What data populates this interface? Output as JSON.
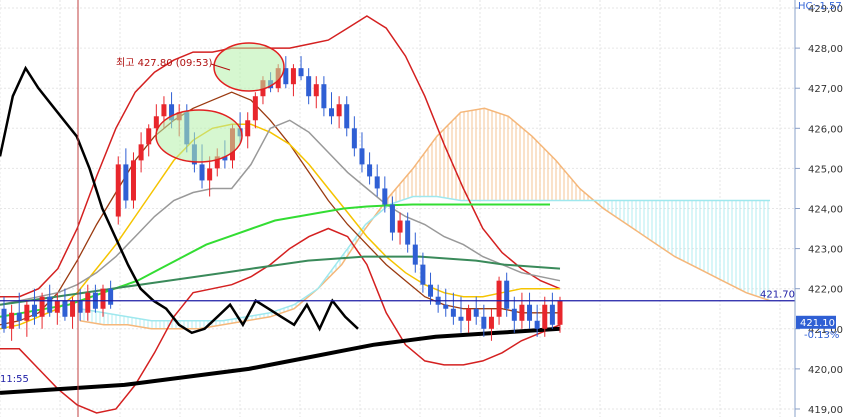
{
  "header": {
    "indicator_text": "HC:-1.57"
  },
  "chart_data": {
    "type": "candlestick",
    "ylim": [
      418.8,
      429.2
    ],
    "y_ticks": [
      "419,00",
      "420,00",
      "421,00",
      "422,00",
      "423,00",
      "424,00",
      "425,00",
      "426,00",
      "427,00",
      "428,00",
      "429,00"
    ],
    "y_tick_values": [
      419,
      420,
      421,
      422,
      423,
      424,
      425,
      426,
      427,
      428,
      429
    ],
    "annotations": {
      "high_label": "최고 427.80 (09:53)",
      "time_label": "11:55",
      "ref_line_label": "421.70",
      "ref_line_value": 421.7,
      "last_price_label": "421.10",
      "last_price_value": 421.1,
      "change_label": "-0.13%"
    },
    "candles": [
      [
        421.5,
        421.8,
        420.9,
        421.0
      ],
      [
        421.0,
        421.6,
        420.7,
        421.4
      ],
      [
        421.4,
        421.9,
        421.0,
        421.2
      ],
      [
        421.2,
        421.7,
        420.8,
        421.6
      ],
      [
        421.6,
        422.0,
        421.1,
        421.3
      ],
      [
        421.3,
        421.9,
        421.0,
        421.8
      ],
      [
        421.8,
        422.1,
        421.3,
        421.4
      ],
      [
        421.4,
        421.9,
        421.1,
        421.7
      ],
      [
        421.7,
        422.0,
        421.2,
        421.3
      ],
      [
        421.3,
        421.8,
        421.0,
        421.7
      ],
      [
        421.7,
        422.0,
        421.2,
        421.4
      ],
      [
        421.4,
        422.1,
        421.2,
        421.9
      ],
      [
        421.9,
        422.1,
        421.4,
        421.5
      ],
      [
        421.5,
        422.1,
        421.3,
        422.0
      ],
      [
        422.0,
        422.2,
        421.5,
        421.6
      ],
      [
        423.8,
        425.3,
        423.6,
        425.1
      ],
      [
        425.1,
        425.5,
        424.0,
        424.2
      ],
      [
        424.2,
        425.4,
        424.0,
        425.2
      ],
      [
        425.2,
        425.9,
        424.9,
        425.6
      ],
      [
        425.6,
        426.1,
        425.3,
        426.0
      ],
      [
        426.0,
        426.6,
        425.7,
        426.3
      ],
      [
        426.3,
        426.8,
        426.0,
        426.6
      ],
      [
        426.6,
        426.9,
        426.0,
        426.2
      ],
      [
        426.2,
        426.6,
        425.8,
        426.4
      ],
      [
        426.4,
        426.6,
        425.4,
        425.6
      ],
      [
        425.6,
        425.9,
        424.9,
        425.1
      ],
      [
        425.1,
        425.6,
        424.5,
        424.7
      ],
      [
        424.7,
        425.3,
        424.3,
        425.0
      ],
      [
        425.0,
        425.5,
        424.8,
        425.3
      ],
      [
        425.3,
        425.7,
        425.0,
        425.2
      ],
      [
        425.2,
        426.1,
        425.0,
        426.0
      ],
      [
        426.0,
        426.4,
        425.6,
        425.8
      ],
      [
        425.8,
        426.4,
        425.5,
        426.2
      ],
      [
        426.2,
        426.9,
        426.0,
        426.8
      ],
      [
        426.8,
        427.3,
        426.6,
        427.2
      ],
      [
        427.2,
        427.4,
        426.9,
        427.0
      ],
      [
        427.0,
        427.6,
        426.9,
        427.5
      ],
      [
        427.5,
        427.8,
        427.0,
        427.1
      ],
      [
        427.1,
        427.6,
        426.8,
        427.5
      ],
      [
        427.5,
        427.8,
        427.2,
        427.3
      ],
      [
        427.3,
        427.5,
        426.6,
        426.8
      ],
      [
        426.8,
        427.3,
        426.5,
        427.1
      ],
      [
        427.1,
        427.3,
        426.3,
        426.5
      ],
      [
        426.5,
        426.9,
        426.1,
        426.3
      ],
      [
        426.3,
        426.8,
        426.0,
        426.6
      ],
      [
        426.6,
        426.8,
        425.8,
        426.0
      ],
      [
        426.0,
        426.3,
        425.3,
        425.5
      ],
      [
        425.5,
        425.9,
        424.9,
        425.1
      ],
      [
        425.1,
        425.4,
        424.6,
        424.8
      ],
      [
        424.8,
        425.1,
        424.3,
        424.5
      ],
      [
        424.5,
        424.8,
        423.9,
        424.1
      ],
      [
        424.1,
        424.3,
        423.2,
        423.4
      ],
      [
        423.4,
        423.9,
        423.1,
        423.7
      ],
      [
        423.7,
        423.9,
        422.9,
        423.1
      ],
      [
        423.1,
        423.4,
        422.4,
        422.6
      ],
      [
        422.6,
        422.9,
        421.9,
        422.1
      ],
      [
        422.1,
        422.4,
        421.6,
        421.8
      ],
      [
        421.8,
        422.1,
        421.4,
        421.6
      ],
      [
        421.6,
        422.0,
        421.3,
        421.5
      ],
      [
        421.5,
        421.9,
        421.1,
        421.3
      ],
      [
        421.3,
        421.8,
        420.9,
        421.2
      ],
      [
        421.2,
        421.6,
        420.9,
        421.5
      ],
      [
        421.5,
        421.8,
        421.1,
        421.3
      ],
      [
        421.3,
        421.6,
        420.8,
        421.0
      ],
      [
        421.0,
        421.5,
        420.7,
        421.3
      ],
      [
        421.3,
        422.3,
        421.1,
        422.2
      ],
      [
        422.2,
        422.4,
        421.3,
        421.5
      ],
      [
        421.5,
        421.8,
        420.9,
        421.2
      ],
      [
        421.2,
        421.9,
        421.0,
        421.6
      ],
      [
        421.6,
        421.9,
        421.0,
        421.2
      ],
      [
        421.2,
        421.6,
        420.8,
        421.0
      ],
      [
        421.0,
        421.8,
        420.8,
        421.6
      ],
      [
        421.6,
        421.9,
        421.0,
        421.1
      ],
      [
        421.1,
        421.8,
        420.9,
        421.7
      ]
    ],
    "lines": {
      "upper_band": [
        421.8,
        421.8,
        422.0,
        422.5,
        423.5,
        424.8,
        426.0,
        426.9,
        427.4,
        427.7,
        427.9,
        427.9,
        428.0,
        428.0,
        428.0,
        428.0,
        428.1,
        428.2,
        428.5,
        428.8,
        428.5,
        427.8,
        426.8,
        425.6,
        424.5,
        423.5,
        422.9,
        422.5,
        422.2,
        422.0
      ],
      "lower_band": [
        420.5,
        420.5,
        420.0,
        419.5,
        419.1,
        418.9,
        419.0,
        419.6,
        420.4,
        421.3,
        421.9,
        422.0,
        422.1,
        422.3,
        422.6,
        423.0,
        423.3,
        423.5,
        423.3,
        422.6,
        421.4,
        420.6,
        420.2,
        420.1,
        420.1,
        420.2,
        420.4,
        420.7,
        420.9,
        421.1
      ],
      "middle_band": [
        421.1,
        421.2,
        421.4,
        421.9,
        422.7,
        423.6,
        424.4,
        425.2,
        425.8,
        426.2,
        426.5,
        426.7,
        426.9,
        426.7,
        426.2,
        425.6,
        424.9,
        424.2,
        423.6,
        423.1,
        422.6,
        422.2,
        421.8,
        421.6,
        421.5,
        421.5,
        421.5,
        421.4,
        421.4,
        421.4
      ],
      "orange_ma": [
        421.0,
        421.1,
        421.3,
        421.5,
        421.9,
        422.5,
        423.1,
        423.8,
        424.5,
        425.2,
        425.7,
        426.0,
        426.1,
        426.1,
        425.9,
        425.6,
        425.1,
        424.5,
        423.9,
        423.3,
        422.8,
        422.4,
        422.1,
        421.9,
        421.8,
        421.8,
        421.9,
        422.0,
        422.0,
        422.0
      ],
      "gray_ma": [
        421.6,
        421.7,
        421.8,
        421.9,
        422.1,
        422.4,
        422.8,
        423.3,
        423.8,
        424.2,
        424.4,
        424.5,
        424.5,
        425.1,
        426.0,
        426.2,
        425.9,
        425.4,
        424.9,
        424.5,
        424.1,
        423.8,
        423.6,
        423.3,
        423.1,
        422.8,
        422.6,
        422.4,
        422.3,
        422.2
      ],
      "green_ma": [
        421.3,
        421.4,
        421.5,
        421.6,
        421.8,
        422.0,
        422.2,
        422.5,
        422.8,
        423.1,
        423.3,
        423.5,
        423.7,
        423.8,
        423.9,
        424.0,
        424.05,
        424.08,
        424.1,
        424.1,
        424.1,
        424.1,
        424.1,
        424.1,
        424.1
      ],
      "darkgreen_ma": [
        421.6,
        421.7,
        421.8,
        421.9,
        422.0,
        422.1,
        422.2,
        422.3,
        422.4,
        422.5,
        422.6,
        422.7,
        422.75,
        422.8,
        422.8,
        422.8,
        422.75,
        422.7,
        422.6,
        422.55,
        422.5
      ],
      "black_thick": [
        419.4,
        419.45,
        419.5,
        419.55,
        419.6,
        419.7,
        419.8,
        419.9,
        420.0,
        420.15,
        420.3,
        420.45,
        420.6,
        420.7,
        420.8,
        420.85,
        420.9,
        420.95,
        421.0
      ],
      "black_thin": [
        425.3,
        426.8,
        427.5,
        427.0,
        426.6,
        426.2,
        425.8,
        425.0,
        424.0,
        423.3,
        422.6,
        422.0,
        421.7,
        421.5,
        421.1,
        420.9,
        421.0,
        421.3,
        421.6,
        421.1,
        421.7,
        421.5,
        421.3,
        421.1,
        421.6,
        421.0,
        421.7,
        421.3,
        421.0
      ]
    },
    "cloud": {
      "span_a": [
        421.2,
        421.1,
        421.1,
        421.0,
        421.0,
        421.0,
        421.1,
        421.2,
        421.3,
        421.5,
        422.0,
        422.6,
        423.5,
        424.3,
        425.0,
        425.8,
        426.4,
        426.5,
        426.3,
        425.8,
        425.2,
        424.5,
        424.0,
        423.6,
        423.2,
        422.8,
        422.5,
        422.2,
        421.9,
        421.7
      ],
      "span_b": [
        421.5,
        421.4,
        421.3,
        421.2,
        421.2,
        421.2,
        421.2,
        421.3,
        421.4,
        421.6,
        422.0,
        422.8,
        423.6,
        424.1,
        424.3,
        424.3,
        424.2,
        424.2,
        424.2,
        424.2,
        424.2,
        424.2,
        424.2,
        424.2,
        424.2,
        424.2,
        424.2,
        424.2,
        424.2,
        424.2
      ]
    }
  },
  "colors": {
    "up": "#e8262c",
    "down": "#2f5fd4",
    "ref_line": "#1e1ea6",
    "upper_band": "#d42020",
    "middle_band": "#9a3a10",
    "orange_ma": "#f5c400",
    "gray_ma": "#999999",
    "green_ma": "#33dd33",
    "darkgreen_ma": "#3a8a5a",
    "black": "#000000",
    "cloud_a": "#f5b77a",
    "cloud_b": "#9fe8ee"
  }
}
